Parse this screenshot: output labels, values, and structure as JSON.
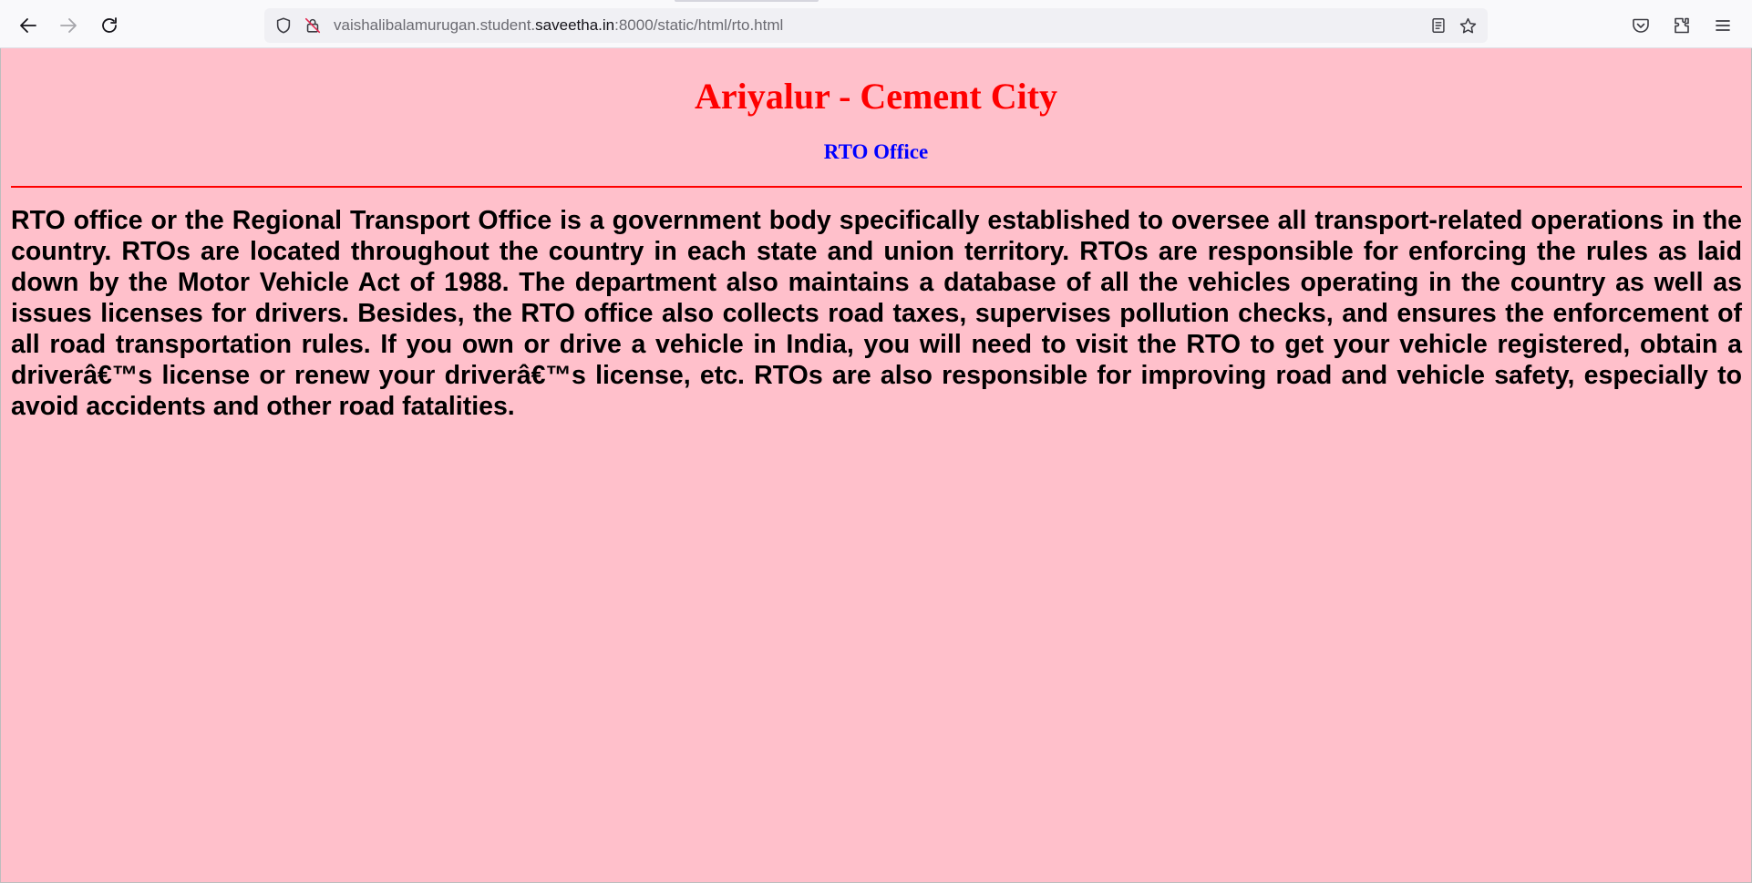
{
  "browser": {
    "url": {
      "prefix": "vaishalibalamurugan.student.",
      "domain": "saveetha.in",
      "suffix": ":8000/static/html/rto.html"
    },
    "icons": {
      "back": "back-arrow-icon",
      "forward": "forward-arrow-icon",
      "reload": "reload-icon",
      "shield": "tracking-protection-shield-icon",
      "insecure": "insecure-connection-icon",
      "reader": "reader-view-icon",
      "bookmark": "bookmark-star-icon",
      "pocket": "pocket-icon",
      "extensions": "extensions-icon",
      "menu": "hamburger-menu-icon"
    }
  },
  "page": {
    "title": "Ariyalur - Cement City",
    "subtitle": "RTO Office",
    "paragraph": "RTO office or the Regional Transport Office is a government body specifically established to oversee all transport-related operations in the country. RTOs are located throughout the country in each state and union territory. RTOs are responsible for enforcing the rules as laid down by the Motor Vehicle Act of 1988. The department also maintains a database of all the vehicles operating in the country as well as issues licenses for drivers. Besides, the RTO office also collects road taxes, supervises pollution checks, and ensures the enforcement of all road transportation rules. If you own or drive a vehicle in India, you will need to visit the RTO to get your vehicle registered, obtain a driverâ€™s license or renew your driverâ€™s license, etc. RTOs are also responsible for improving road and vehicle safety, especially to avoid accidents and other road fatalities."
  },
  "colors": {
    "background": "#ffc0cb",
    "title": "#ff0000",
    "subtitle": "#0000ff",
    "rule": "#ff0000"
  }
}
